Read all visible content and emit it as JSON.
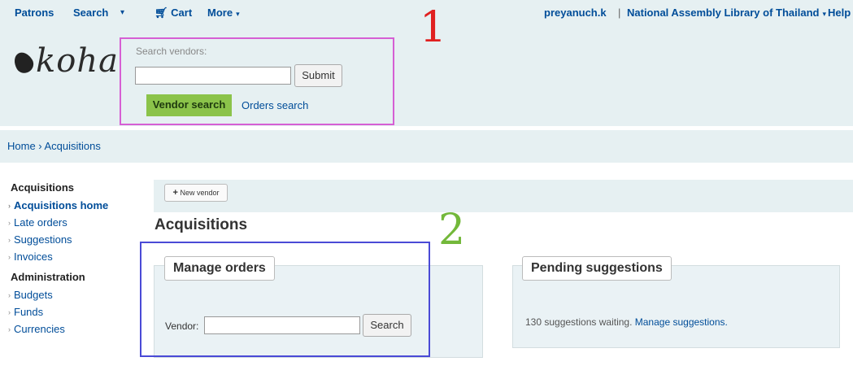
{
  "topnav": {
    "patrons": "Patrons",
    "search": "Search",
    "cart": "Cart",
    "more": "More",
    "user": "preyanuch.k",
    "library": "National Assembly Library of Thailand",
    "help": "Help"
  },
  "logo": {
    "text": "koha"
  },
  "vendor_search": {
    "label": "Search vendors:",
    "input_value": "",
    "submit_label": "Submit",
    "tab_vendor": "Vendor search",
    "tab_orders": "Orders search"
  },
  "annotations": {
    "mark1": "1",
    "mark2": "2"
  },
  "breadcrumb": "Home › Acquisitions",
  "sidebar": {
    "acq_heading": "Acquisitions",
    "acq_items": [
      "Acquisitions home",
      "Late orders",
      "Suggestions",
      "Invoices"
    ],
    "admin_heading": "Administration",
    "admin_items": [
      "Budgets",
      "Funds",
      "Currencies"
    ]
  },
  "toolbar": {
    "new_vendor": "New vendor"
  },
  "page_title": "Acquisitions",
  "manage_orders": {
    "title": "Manage orders",
    "vendor_label": "Vendor:",
    "vendor_value": "",
    "search_label": "Search"
  },
  "pending": {
    "title": "Pending suggestions",
    "text": "130 suggestions waiting.",
    "link": "Manage suggestions."
  },
  "colors": {
    "header_bg": "#e6f0f2",
    "link": "#004d99",
    "active_tab": "#8bc34a",
    "annotation_pink": "#d65fd4",
    "annotation_blue": "#4a4ad6",
    "annotation_red": "#e02020",
    "annotation_green": "#73b83a"
  },
  "icons": {
    "cart": "cart-icon",
    "new_vendor": "plus-icon"
  }
}
